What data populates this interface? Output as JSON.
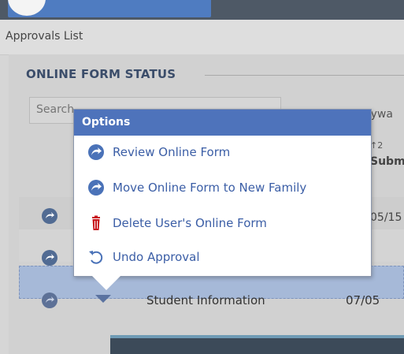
{
  "breadcrumb": "Approvals List",
  "section": {
    "title": "ONLINE FORM STATUS"
  },
  "search": {
    "placeholder": "Search"
  },
  "keyword_label": "kywa",
  "column": {
    "sort_indicator": "↑2",
    "header": "Subm"
  },
  "rows": [
    {
      "date": "05/15"
    },
    {
      "date": ""
    },
    {
      "label": "Student Information",
      "date": "07/05"
    }
  ],
  "menu": {
    "title": "Options",
    "items": [
      {
        "label": "Review Online Form",
        "icon": "circle-arrow-icon"
      },
      {
        "label": "Move Online Form to New Family",
        "icon": "circle-arrow-icon"
      },
      {
        "label": "Delete User's Online Form",
        "icon": "trash-icon"
      },
      {
        "label": "Undo Approval",
        "icon": "undo-icon"
      }
    ]
  },
  "colors": {
    "accent": "#4e73bb",
    "menu_text": "#3b5ea6",
    "delete": "#c8161d",
    "selected_row": "#a6b9d8"
  }
}
